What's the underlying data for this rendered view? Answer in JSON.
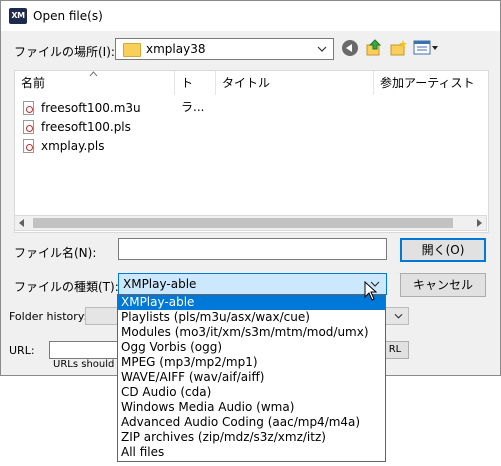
{
  "window": {
    "title": "Open file(s)",
    "app_icon_text": "XM"
  },
  "location": {
    "label": "ファイルの場所(I):",
    "value": "xmplay38"
  },
  "filelist": {
    "columns": [
      "名前",
      "トラ...",
      "タイトル",
      "参加アーティスト"
    ],
    "files": [
      "freesoft100.m3u",
      "freesoft100.pls",
      "xmplay.pls"
    ]
  },
  "filename": {
    "label": "ファイル名(N):",
    "value": ""
  },
  "filetype": {
    "label": "ファイルの種類(T):",
    "value": "XMPlay-able",
    "options": [
      "XMPlay-able",
      "Playlists (pls/m3u/asx/wax/cue)",
      "Modules (mo3/it/xm/s3m/mtm/mod/umx)",
      "Ogg Vorbis (ogg)",
      "MPEG (mp3/mp2/mp1)",
      "WAVE/AIFF (wav/aif/aiff)",
      "CD Audio (cda)",
      "Windows Media Audio (wma)",
      "Advanced Audio Coding (aac/mp4/m4a)",
      "ZIP archives (zip/mdz/s3z/xmz/itz)",
      "All files"
    ]
  },
  "buttons": {
    "open": "開く(O)",
    "cancel": "キャンセル",
    "url_btn": "RL"
  },
  "folder_history": {
    "label": "Folder history:"
  },
  "url": {
    "label": "URL:",
    "hint": "URLs should b"
  },
  "colors": {
    "selection": "#0078d7",
    "combo_highlight": "#cce8ff"
  }
}
